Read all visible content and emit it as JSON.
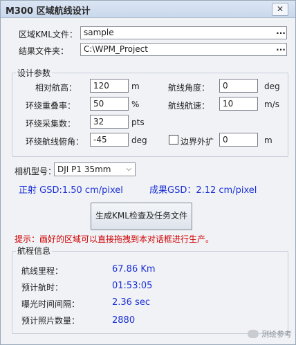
{
  "window": {
    "title": "M300 区域航线设计",
    "close_symbol": "✕"
  },
  "files": {
    "kml_label": "区域KML文件：",
    "kml_value": "sample",
    "result_label": "结果文件夹：",
    "result_value": "C:\\WPM_Project",
    "browse_label": "..."
  },
  "params": {
    "group_title": "设计参数",
    "altitude_label": "相对航高：",
    "altitude_value": "120",
    "altitude_unit": "m",
    "overlap_label": "环绕重叠率：",
    "overlap_value": "50",
    "overlap_unit": "%",
    "samples_label": "环绕采集数：",
    "samples_value": "32",
    "samples_unit": "pts",
    "pitch_label": "环绕航线俯角：",
    "pitch_value": "-45",
    "pitch_unit": "deg",
    "heading_label": "航线角度：",
    "heading_value": "0",
    "heading_unit": "deg",
    "speed_label": "航线航速：",
    "speed_value": "10",
    "speed_unit": "m/s",
    "expand_label": "边界外扩",
    "expand_value": "0",
    "expand_unit": "m"
  },
  "camera": {
    "label": "相机型号：",
    "selected": "DJI P1 35mm",
    "ortho_gsd": "正射 GSD:1.50 cm/pixel",
    "result_gsd": "成果GSD：2.12 cm/pixel"
  },
  "generate_button": "生成KML检查及任务文件",
  "tip": "提示：画好的区域可以直接拖拽到本对话框进行生产。",
  "route_info": {
    "group_title": "航程信息",
    "distance_label": "航线里程：",
    "distance_value": "67.86 Km",
    "time_label": "预计航时：",
    "time_value": "01:53:05",
    "interval_label": "曝光时间间隔：",
    "interval_value": "2.36 sec",
    "photos_label": "预计照片数量：",
    "photos_value": "2880"
  },
  "watermark": "测绘参考"
}
